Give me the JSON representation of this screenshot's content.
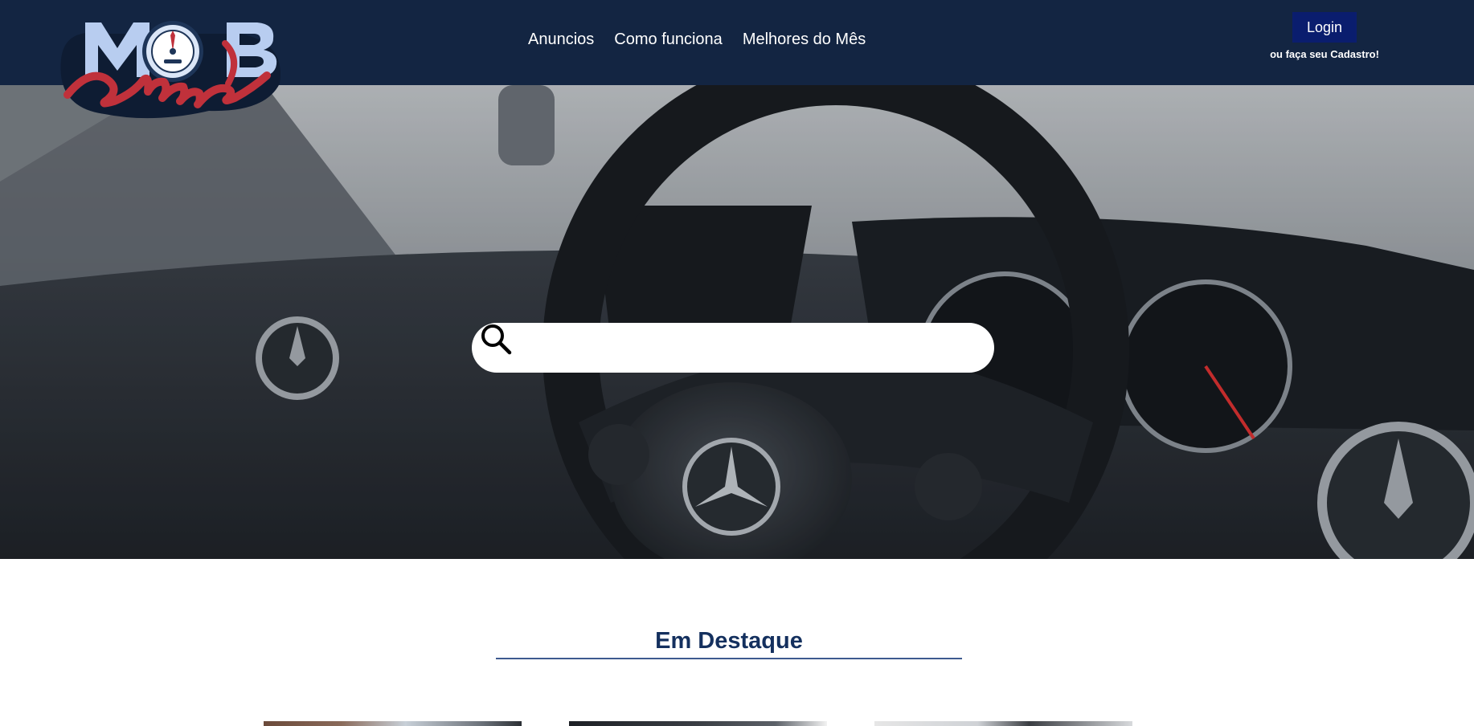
{
  "header": {
    "logo": {
      "top_text": "MOB",
      "script_text": "share"
    },
    "nav": [
      {
        "label": "Anuncios"
      },
      {
        "label": "Como funciona"
      },
      {
        "label": "Melhores do Mês"
      }
    ],
    "login_label": "Login",
    "signup_text": "ou faça seu Cadastro!"
  },
  "hero": {
    "search": {
      "value": "",
      "placeholder": ""
    }
  },
  "featured": {
    "title": "Em Destaque"
  },
  "colors": {
    "header_bg": "#132542",
    "login_bg": "#0a1d6e",
    "logo_red": "#c0313b",
    "logo_light_blue": "#b8cdf0",
    "title_blue": "#14305e"
  }
}
